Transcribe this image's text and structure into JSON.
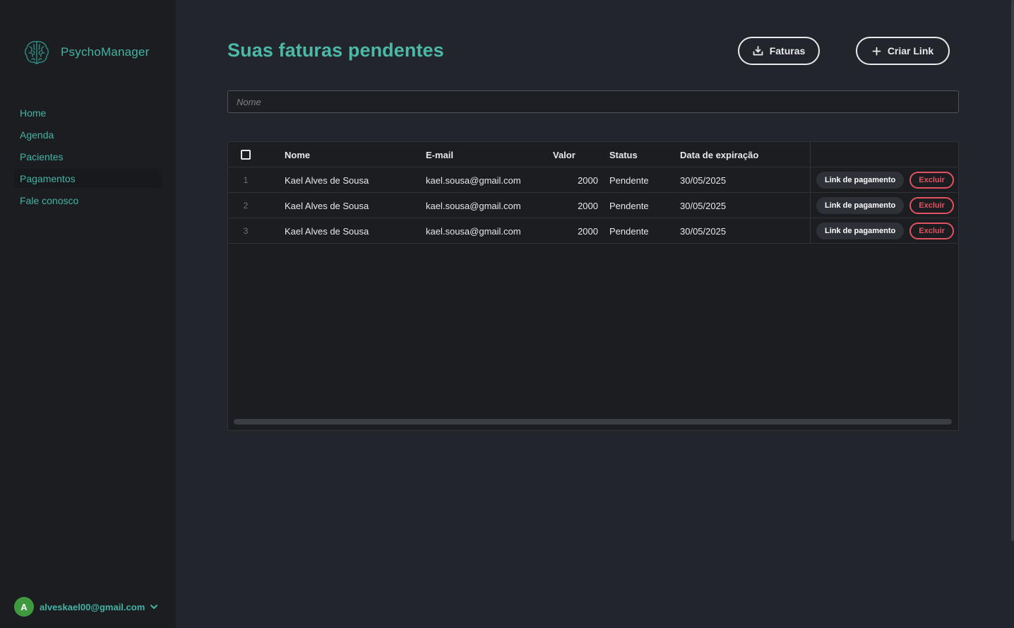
{
  "app": {
    "name": "PsychoManager",
    "logo_icon": "brain-icon"
  },
  "sidebar": {
    "items": [
      {
        "label": "Home",
        "active": false
      },
      {
        "label": "Agenda",
        "active": false
      },
      {
        "label": "Pacientes",
        "active": false
      },
      {
        "label": "Pagamentos",
        "active": true
      },
      {
        "label": "Fale conosco",
        "active": false
      }
    ]
  },
  "user": {
    "initial": "A",
    "email": "alveskael00@gmail.com",
    "menu_icon": "chevron-down-icon"
  },
  "header": {
    "title": "Suas faturas pendentes",
    "faturas_label": "Faturas",
    "faturas_icon": "download-icon",
    "criar_label": "Criar Link",
    "criar_icon": "plus-icon"
  },
  "search": {
    "placeholder": "Nome",
    "value": ""
  },
  "table": {
    "columns": {
      "nome": "Nome",
      "email": "E-mail",
      "valor": "Valor",
      "status": "Status",
      "data": "Data de expiração"
    },
    "rows": [
      {
        "num": "1",
        "nome": "Kael Alves de Sousa",
        "email": "kael.sousa@gmail.com",
        "valor": "2000",
        "status": "Pendente",
        "data": "30/05/2025",
        "link_label": "Link de pagamento",
        "excluir_label": "Excluir"
      },
      {
        "num": "2",
        "nome": "Kael Alves de Sousa",
        "email": "kael.sousa@gmail.com",
        "valor": "2000",
        "status": "Pendente",
        "data": "30/05/2025",
        "link_label": "Link de pagamento",
        "excluir_label": "Excluir"
      },
      {
        "num": "3",
        "nome": "Kael Alves de Sousa",
        "email": "kael.sousa@gmail.com",
        "valor": "2000",
        "status": "Pendente",
        "data": "30/05/2025",
        "link_label": "Link de pagamento",
        "excluir_label": "Excluir"
      }
    ]
  },
  "colors": {
    "accent": "#45b3a3",
    "danger": "#e05260",
    "sidebar_bg": "#1b1d21",
    "page_bg": "#22252b"
  }
}
